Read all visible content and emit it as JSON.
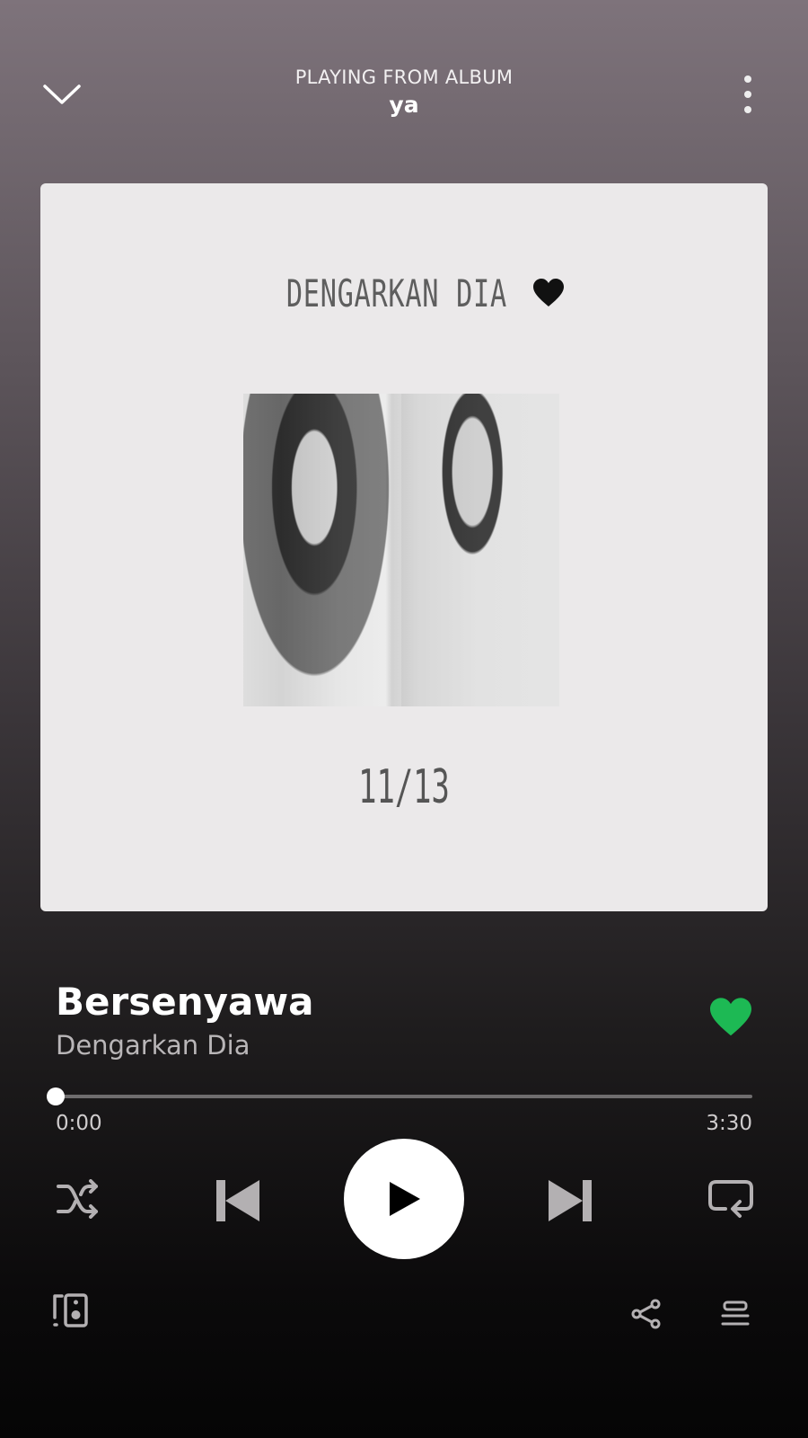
{
  "header": {
    "context_label": "PLAYING FROM ALBUM",
    "album_name": "ya",
    "collapse_icon": "chevron-down-icon",
    "more_icon": "more-vertical-icon"
  },
  "album_art": {
    "title_text": "DENGARKAN DIA",
    "date_text": "11/13"
  },
  "track": {
    "title": "Bersenyawa",
    "artist": "Dengarkan Dia",
    "liked": true,
    "like_color": "#1db954"
  },
  "progress": {
    "elapsed": "0:00",
    "duration": "3:30",
    "fraction": 0.0
  },
  "controls": {
    "shuffle_icon": "shuffle-icon",
    "previous_icon": "skip-previous-icon",
    "play_icon": "play-icon",
    "next_icon": "skip-next-icon",
    "repeat_icon": "repeat-icon"
  },
  "footer": {
    "devices_icon": "devices-icon",
    "share_icon": "share-icon",
    "queue_icon": "queue-icon"
  }
}
